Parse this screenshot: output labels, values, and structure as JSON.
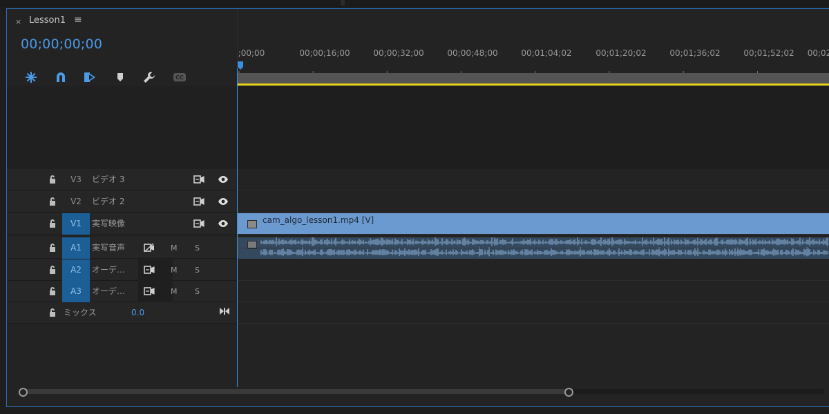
{
  "panel": {
    "tab_title": "Lesson1",
    "tab_close": "×",
    "tab_menu": "≡",
    "timecode": "00;00;00;00"
  },
  "toolbar": [
    {
      "name": "nest-icon"
    },
    {
      "name": "snap-icon"
    },
    {
      "name": "linked-selection-icon"
    },
    {
      "name": "add-marker-icon"
    },
    {
      "name": "settings-wrench-icon"
    },
    {
      "name": "captions-icon"
    }
  ],
  "ruler": {
    "labels": [
      ";00;00",
      "00;00;16;00",
      "00;00;32;00",
      "00;00;48;00",
      "00;01;04;02",
      "00;01;20;02",
      "00;01;36;02",
      "00;01;52;02",
      "00;02"
    ]
  },
  "tracks": {
    "v3": {
      "id": "V3",
      "label": "ビデオ 3"
    },
    "v2": {
      "id": "V2",
      "label": "ビデオ 2"
    },
    "v1": {
      "id": "V1",
      "label": "実写映像"
    },
    "a1": {
      "id": "A1",
      "label": "実写音声",
      "m": "M",
      "s": "S"
    },
    "a2": {
      "id": "A2",
      "label": "オーデ…",
      "m": "M",
      "s": "S"
    },
    "a3": {
      "id": "A3",
      "label": "オーデ…",
      "m": "M",
      "s": "S"
    }
  },
  "mix": {
    "label": "ミックス",
    "value": "0.0"
  },
  "clips": {
    "video": {
      "name": "cam_algo_lesson1.mp4 [V]",
      "fx": "fx"
    },
    "audio": {
      "fx": "fx"
    }
  },
  "colors": {
    "accent": "#4a9be8",
    "work_area": "#e6d21a",
    "video_clip": "#6b9ad0",
    "audio_clip": "#35495e",
    "active_track": "#1c5f96"
  }
}
